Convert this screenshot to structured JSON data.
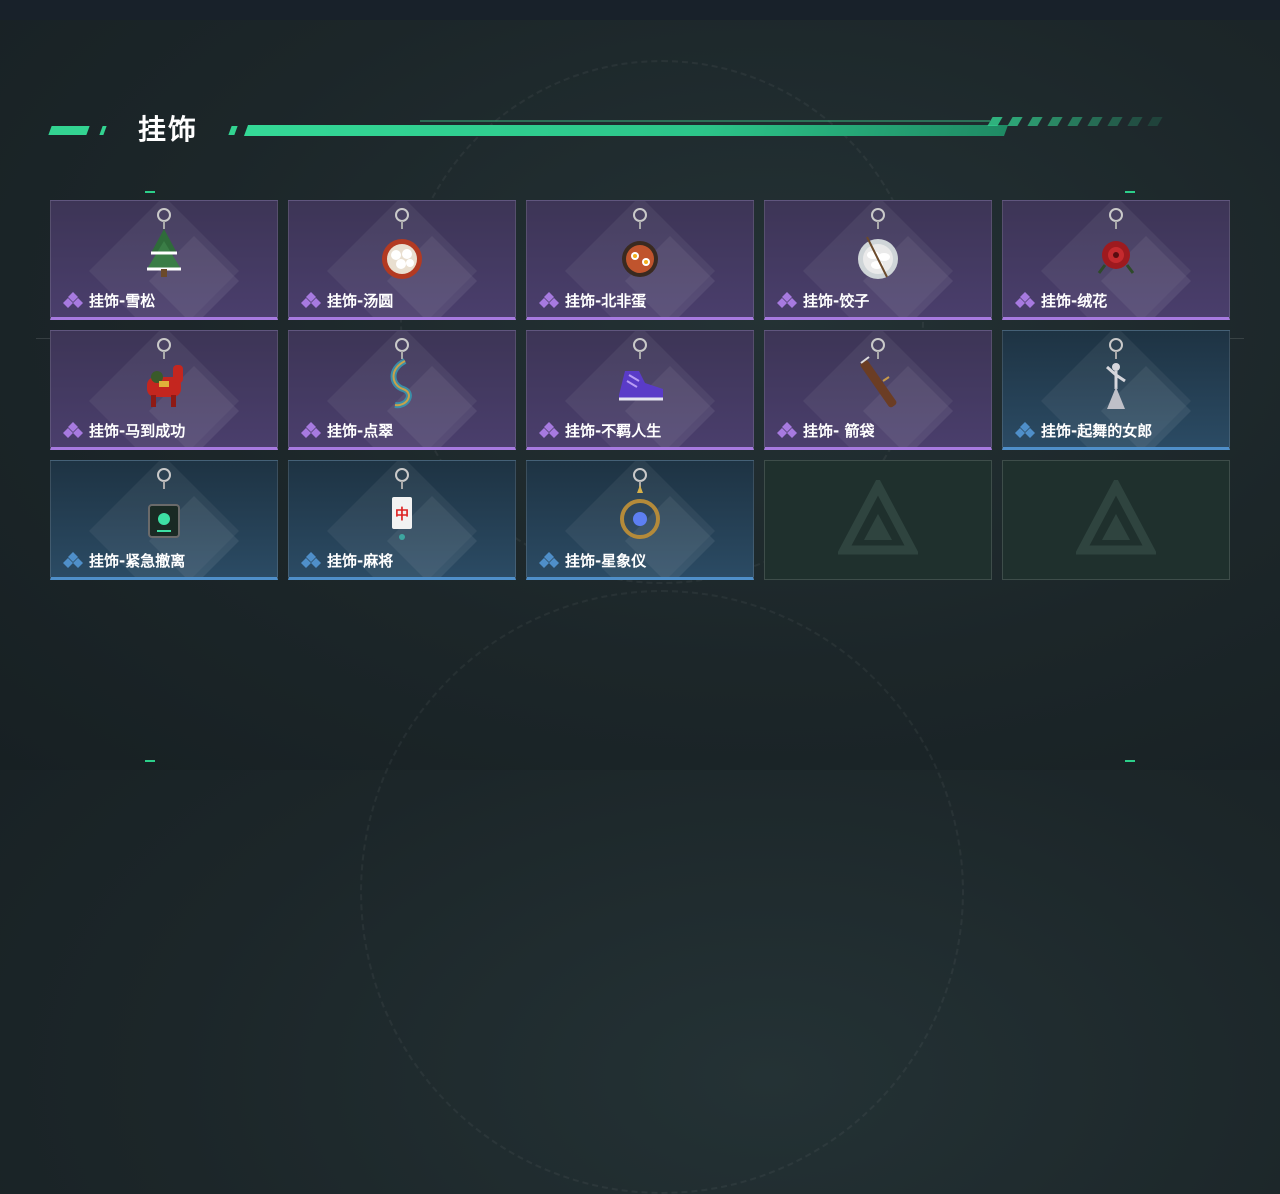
{
  "section": {
    "title": "挂饰"
  },
  "colors": {
    "accent": "#33d391",
    "rarity_epic": "#a77ae0",
    "rarity_rare": "#4f8fc9"
  },
  "items": [
    {
      "label": "挂饰-雪松",
      "rarity": "epic",
      "icon": "pine-tree-charm-icon"
    },
    {
      "label": "挂饰-汤圆",
      "rarity": "epic",
      "icon": "tangyuan-bowl-charm-icon"
    },
    {
      "label": "挂饰-北非蛋",
      "rarity": "epic",
      "icon": "shakshuka-pan-charm-icon"
    },
    {
      "label": "挂饰-饺子",
      "rarity": "epic",
      "icon": "dumpling-plate-charm-icon"
    },
    {
      "label": "挂饰-绒花",
      "rarity": "epic",
      "icon": "red-velvet-flower-charm-icon"
    },
    {
      "label": "挂饰-马到成功",
      "rarity": "epic",
      "icon": "red-horse-charm-icon"
    },
    {
      "label": "挂饰-点翠",
      "rarity": "epic",
      "icon": "kingfisher-feather-charm-icon"
    },
    {
      "label": "挂饰-不羁人生",
      "rarity": "epic",
      "icon": "purple-sneaker-charm-icon"
    },
    {
      "label": "挂饰- 箭袋",
      "rarity": "epic",
      "icon": "quiver-charm-icon"
    },
    {
      "label": "挂饰-起舞的女郎",
      "rarity": "rare",
      "icon": "dancing-lady-charm-icon"
    },
    {
      "label": "挂饰-紧急撤离",
      "rarity": "rare",
      "icon": "emergency-exit-charm-icon"
    },
    {
      "label": "挂饰-麻将",
      "rarity": "rare",
      "icon": "mahjong-tile-charm-icon"
    },
    {
      "label": "挂饰-星象仪",
      "rarity": "rare",
      "icon": "astrolabe-charm-icon"
    },
    {
      "label": "",
      "rarity": "empty",
      "icon": "empty-slot-logo-icon"
    },
    {
      "label": "",
      "rarity": "empty",
      "icon": "empty-slot-logo-icon"
    }
  ]
}
